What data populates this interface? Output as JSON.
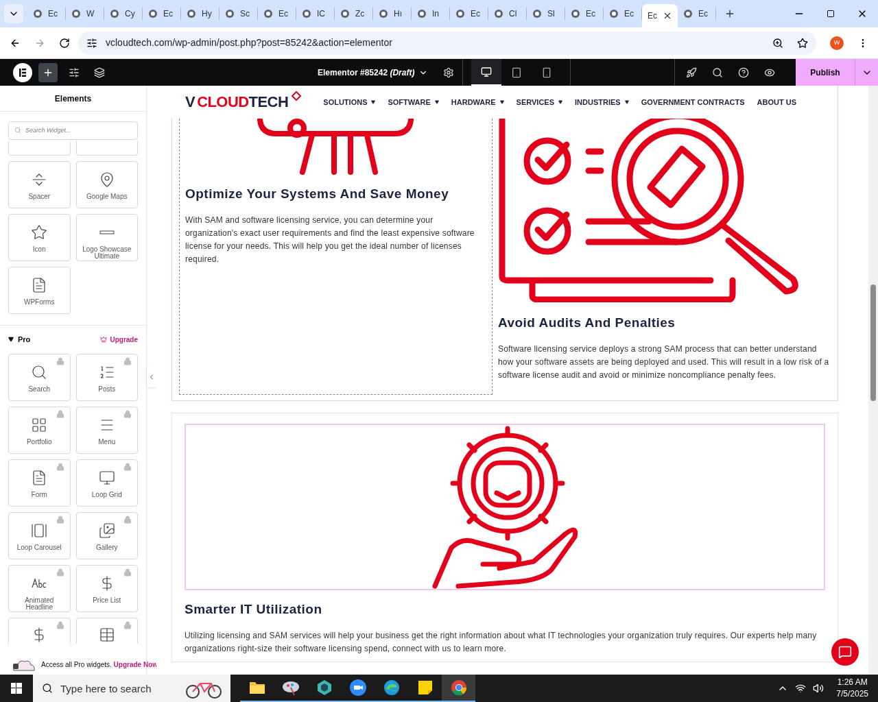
{
  "browser": {
    "tabs": [
      {
        "label": "Ec",
        "selected": false
      },
      {
        "label": "W",
        "selected": false
      },
      {
        "label": "Cy",
        "selected": false
      },
      {
        "label": "Ec",
        "selected": false
      },
      {
        "label": "Hy",
        "selected": false
      },
      {
        "label": "Sc",
        "selected": false
      },
      {
        "label": "Ec",
        "selected": false
      },
      {
        "label": "IC",
        "selected": false
      },
      {
        "label": "Zc",
        "selected": false
      },
      {
        "label": "Hı",
        "selected": false
      },
      {
        "label": "In",
        "selected": false
      },
      {
        "label": "Ec",
        "selected": false
      },
      {
        "label": "Cl",
        "selected": false
      },
      {
        "label": "Sl",
        "selected": false
      },
      {
        "label": "Ec",
        "selected": false
      },
      {
        "label": "Ec",
        "selected": false
      },
      {
        "label": "Ec",
        "selected": true
      },
      {
        "label": "Ec",
        "selected": false
      }
    ],
    "url": "vcloudtech.com/wp-admin/post.php?post=85242&action=elementor",
    "profile_initial": "W"
  },
  "editor_toolbar": {
    "document_title": "Elementor #85242",
    "status": "(Draft)",
    "publish": "Publish",
    "devices": [
      {
        "kind": "desktop",
        "selected": true
      },
      {
        "kind": "tablet",
        "selected": false
      },
      {
        "kind": "mobile",
        "selected": false
      }
    ]
  },
  "panel": {
    "title": "Elements",
    "search_placeholder": "Search Widget...",
    "widgets": [
      {
        "kind": "cut"
      },
      {
        "kind": "cut"
      },
      {
        "kind": "spacer",
        "label": "Spacer"
      },
      {
        "kind": "map",
        "label": "Google Maps"
      },
      {
        "kind": "icon",
        "label": "Icon"
      },
      {
        "kind": "logos",
        "label": "Logo Showcase Ultimate"
      },
      {
        "kind": "form",
        "label": "WPForms"
      }
    ],
    "pro": {
      "title": "Pro",
      "expanded": true,
      "upgrade": "Upgrade",
      "widgets": [
        {
          "kind": "search",
          "label": "Search",
          "locked": true
        },
        {
          "kind": "posts",
          "label": "Posts",
          "locked": true
        },
        {
          "kind": "portfolio",
          "label": "Portfolio",
          "locked": true
        },
        {
          "kind": "menu",
          "label": "Menu",
          "locked": true
        },
        {
          "kind": "form",
          "label": "Form",
          "locked": true
        },
        {
          "kind": "loopgrid",
          "label": "Loop Grid",
          "locked": true
        },
        {
          "kind": "carousel",
          "label": "Loop Carousel",
          "locked": true
        },
        {
          "kind": "gallery",
          "label": "Gallery",
          "locked": true
        },
        {
          "kind": "headline",
          "label": "Animated Headline",
          "locked": true
        },
        {
          "kind": "pricelist",
          "label": "Price List",
          "locked": true
        },
        {
          "kind": "pricetable",
          "locked": true
        },
        {
          "kind": "document",
          "locked": true
        }
      ]
    },
    "promo": {
      "text": "Access all Pro widgets.",
      "link": "Upgrade Now"
    }
  },
  "site": {
    "logo": [
      {
        "text": "V",
        "accent": false
      },
      {
        "text": "CLOUD",
        "accent": true
      },
      {
        "text": "TECH",
        "accent": false
      }
    ],
    "nav": [
      {
        "label": "SOLUTIONS",
        "has_dropdown": true
      },
      {
        "label": "SOFTWARE",
        "has_dropdown": true
      },
      {
        "label": "HARDWARE",
        "has_dropdown": true
      },
      {
        "label": "SERVICES",
        "has_dropdown": true
      },
      {
        "label": "INDUSTRIES",
        "has_dropdown": true
      },
      {
        "label": "GOVERNMENT CONTRACTS",
        "has_dropdown": false
      },
      {
        "label": "ABOUT US",
        "has_dropdown": false
      }
    ],
    "sections": [
      {
        "kind": "two_column",
        "columns": [
          {
            "illustration": {
              "kind": "presentation"
            },
            "title": "Optimize Your Systems And Save Money",
            "body": "With SAM and software licensing service, you can determine your organization's exact user requirements and find the least expensive software license for your needs. This will help you get the ideal number of licenses required."
          },
          {
            "illustration": {
              "kind": "audit"
            },
            "title": "Avoid Audits And Penalties",
            "body": "Software licensing service deploys a strong SAM process that can better understand how your software assets are being deployed and used. This will result in a low risk of a software license audit and avoid or minimize noncompliance penalty fees."
          }
        ]
      },
      {
        "kind": "full",
        "columns": [
          {
            "illustration": {
              "kind": "support"
            },
            "title": "Smarter IT Utilization",
            "body": "Utilizing licensing and SAM services will help your business get the right information about what IT technologies your organization truly requires. Our experts help many organizations right-size their software licensing spend, connect with us to learn more."
          }
        ]
      }
    ]
  },
  "taskbar": {
    "search_placeholder": "Type here to search",
    "time": "1:26 AM",
    "date": "7/5/2025",
    "apps": [
      {
        "kind": "explorer",
        "selected": false
      },
      {
        "kind": "paint",
        "selected": false
      },
      {
        "kind": "cube",
        "selected": false
      },
      {
        "kind": "zoom",
        "selected": false
      },
      {
        "kind": "edge",
        "selected": false
      },
      {
        "kind": "notes",
        "selected": false
      },
      {
        "kind": "chrome",
        "selected": true
      }
    ]
  }
}
